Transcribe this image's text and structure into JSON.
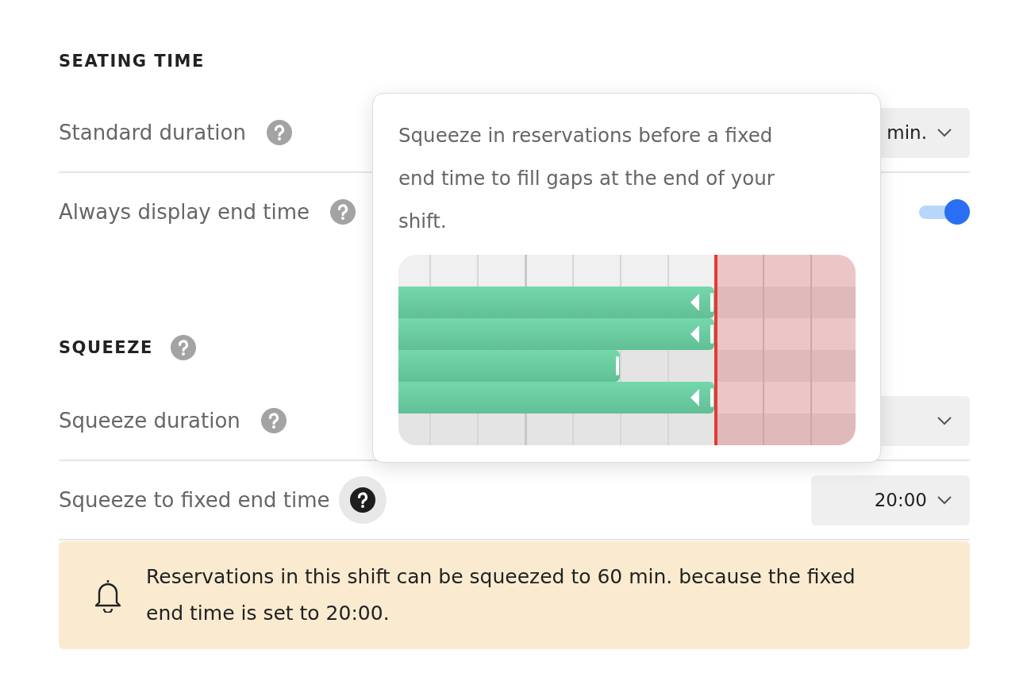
{
  "sections": [
    {
      "title": "SEATING TIME",
      "rows": [
        {
          "label": "Standard duration",
          "help": {
            "active": false
          },
          "kind": "select",
          "value": "min."
        },
        {
          "label": "Always display end time",
          "help": {
            "active": false
          },
          "kind": "toggle",
          "on": true
        }
      ]
    },
    {
      "title": "SQUEEZE",
      "help": {
        "active": false
      },
      "rows": [
        {
          "label": "Squeeze duration",
          "help": {
            "active": false
          },
          "kind": "select"
        },
        {
          "label": "Squeeze to fixed end time",
          "help": {
            "active": true
          },
          "kind": "select",
          "value": "20:00"
        }
      ],
      "alert": {
        "text": "Reservations in this shift can be squeezed to 60 min. because the fixed end time is set to 20:00."
      }
    }
  ],
  "tooltip": {
    "text": "Squeeze in reservations before a fixed end time to fill gaps at the end of your shift."
  }
}
